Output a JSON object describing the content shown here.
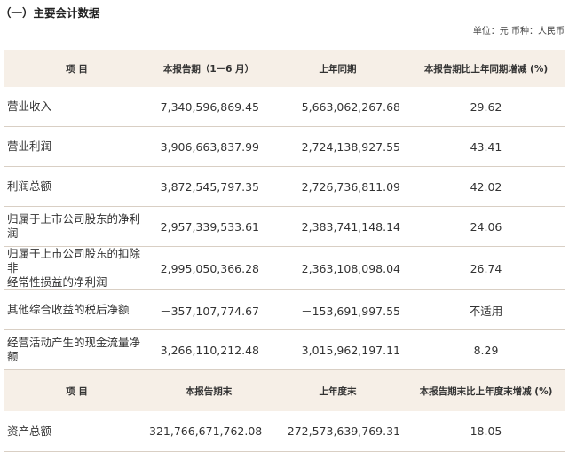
{
  "section_title": "（一）主要会计数据",
  "unit_note": "单位：元  币种：人民币",
  "table": {
    "header1": {
      "item": "项  目",
      "current_period": "本报告期（1－6 月）",
      "prior_period": "上年同期",
      "change": "本报告期比上年同期增减 (%)"
    },
    "income_rows": [
      {
        "label": "营业收入",
        "current": "7,340,596,869.45",
        "prior": "5,663,062,267.68",
        "change": "29.62"
      },
      {
        "label": "营业利润",
        "current": "3,906,663,837.99",
        "prior": "2,724,138,927.55",
        "change": "43.41"
      },
      {
        "label": "利润总额",
        "current": "3,872,545,797.35",
        "prior": "2,726,736,811.09",
        "change": "42.02"
      },
      {
        "label": "归属于上市公司股东的净利润",
        "current": "2,957,339,533.61",
        "prior": "2,383,741,148.14",
        "change": "24.06"
      },
      {
        "label_line1": "归属于上市公司股东的扣除非",
        "label_line2": "经常性损益的净利润",
        "current": "2,995,050,366.28",
        "prior": "2,363,108,098.04",
        "change": "26.74"
      },
      {
        "label": "其他综合收益的税后净额",
        "current": "－357,107,774.67",
        "prior": "－153,691,997.55",
        "change": "不适用"
      },
      {
        "label": "经营活动产生的现金流量净额",
        "current": "3,266,110,212.48",
        "prior": "3,015,962,197.11",
        "change": "8.29"
      }
    ],
    "header2": {
      "item": "项  目",
      "period_end": "本报告期末",
      "prior_year_end": "上年度末",
      "change": "本报告期末比上年度末增减 (%)"
    },
    "balance_rows": [
      {
        "label": "资产总额",
        "current": "321,766,671,762.08",
        "prior": "272,573,639,769.31",
        "change": "18.05"
      }
    ]
  }
}
